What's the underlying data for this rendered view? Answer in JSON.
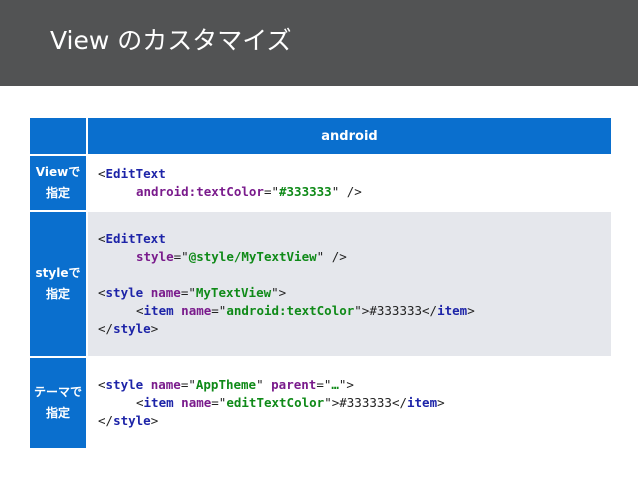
{
  "header": {
    "title": "View のカスタマイズ"
  },
  "table": {
    "column_header": "android",
    "rows": [
      {
        "label_line1": "Viewで",
        "label_line2": "指定"
      },
      {
        "label_line1": "styleで",
        "label_line2": "指定"
      },
      {
        "label_line1": "テーマで",
        "label_line2": "指定"
      }
    ]
  },
  "code": {
    "row1": {
      "open": "<",
      "tag_edittext": "EditText",
      "attr_textcolor": "android:textColor",
      "eq_quote": "=\"",
      "val_color": "#333333",
      "end_selfclose": "\" />"
    },
    "row2": {
      "open": "<",
      "tag_edittext": "EditText",
      "attr_style": "style",
      "eq_quote": "=\"",
      "val_style": "@style/MyTextView",
      "end_selfclose": "\" />",
      "tag_style": "style",
      "attr_name": "name",
      "val_name": "MyTextView",
      "end_open": "\">",
      "tag_item": "item",
      "val_item_name": "android:textColor",
      "item_text": "#333333",
      "close_open": "</",
      "close_end": ">"
    },
    "row3": {
      "open": "<",
      "tag_style": "style",
      "attr_name": "name",
      "eq_quote": "=\"",
      "val_name": "AppTheme",
      "sep": "\" ",
      "attr_parent": "parent",
      "val_parent": "…",
      "end_open": "\">",
      "tag_item": "item",
      "val_item_name": "editTextColor",
      "item_text": "#333333",
      "close_open": "</",
      "close_end": ">"
    }
  },
  "colors": {
    "header_bg": "#525354",
    "table_accent": "#0a6fce",
    "row_alt": "#e5e7ec",
    "code_tag": "#1d24a8",
    "code_attr": "#7a1b8c",
    "code_string": "#0f8a18"
  }
}
